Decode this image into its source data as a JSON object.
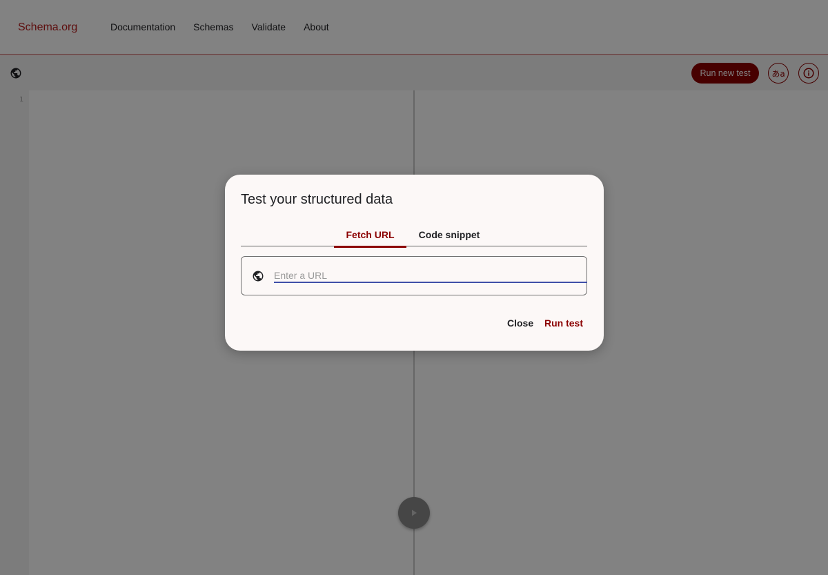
{
  "header": {
    "brand": "Schema.org",
    "nav": [
      "Documentation",
      "Schemas",
      "Validate",
      "About"
    ]
  },
  "toolbar": {
    "run_new_label": "Run new test",
    "lang_label": "あa",
    "icons": [
      "globe-icon",
      "language-icon",
      "info-icon"
    ]
  },
  "editor": {
    "line_numbers": [
      "1"
    ]
  },
  "dialog": {
    "title": "Test your structured data",
    "tabs": [
      {
        "label": "Fetch URL",
        "active": true
      },
      {
        "label": "Code snippet",
        "active": false
      }
    ],
    "url_placeholder": "Enter a URL",
    "url_value": "",
    "close_label": "Close",
    "run_label": "Run test"
  },
  "colors": {
    "accent": "#8b0000",
    "brand": "#b71c1c",
    "input_underline": "#3f4fa8"
  }
}
